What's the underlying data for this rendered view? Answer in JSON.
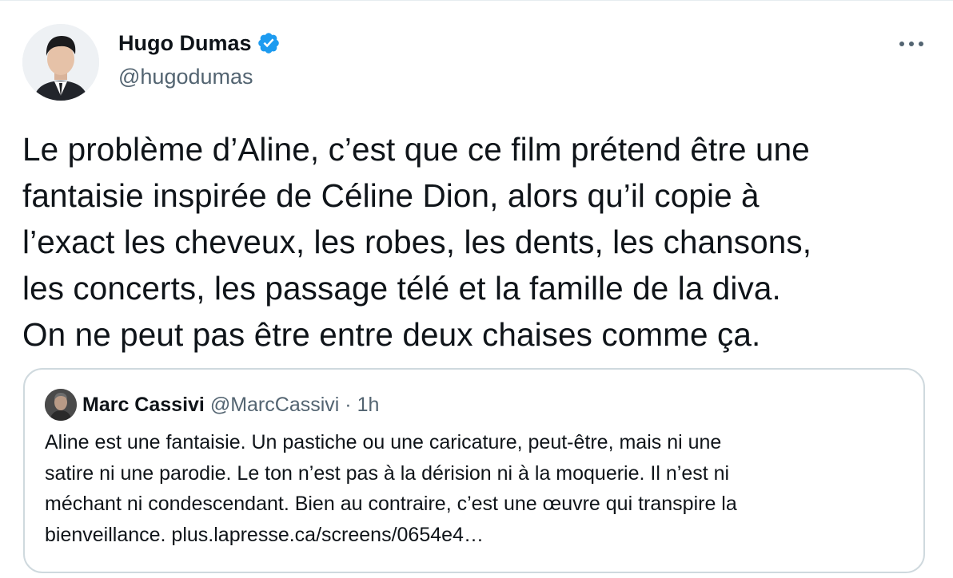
{
  "tweet": {
    "author": {
      "display_name": "Hugo Dumas",
      "handle": "@hugodumas",
      "verified": true,
      "avatar_icon": "profile-photo"
    },
    "text_lines": [
      "Le problème d’Aline, c’est que ce film prétend être une",
      "fantaisie inspirée de Céline Dion, alors qu’il copie à",
      "l’exact les cheveux, les robes, les dents, les chansons,",
      "les concerts, les passage télé et la famille de la diva.",
      "On ne peut pas être entre deux chaises comme ça."
    ],
    "more_icon": "more-horizontal-icon"
  },
  "quoted_tweet": {
    "display_name": "Marc Cassivi",
    "handle": "@MarcCassivi",
    "separator": "·",
    "time": "1h",
    "text_lines": [
      "Aline est une fantaisie. Un pastiche ou une caricature, peut-être, mais ni une",
      "satire ni une parodie. Le ton n’est pas à la dérision ni à la moquerie. Il n’est ni",
      "méchant ni condescendant. Bien au contraire, c’est une œuvre qui transpire la",
      "bienveillance. plus.lapresse.ca/screens/0654e4…"
    ]
  },
  "colors": {
    "text_primary": "#0f1419",
    "text_secondary": "#536471",
    "verified_badge": "#1d9bf0",
    "border": "#cfd9de"
  }
}
